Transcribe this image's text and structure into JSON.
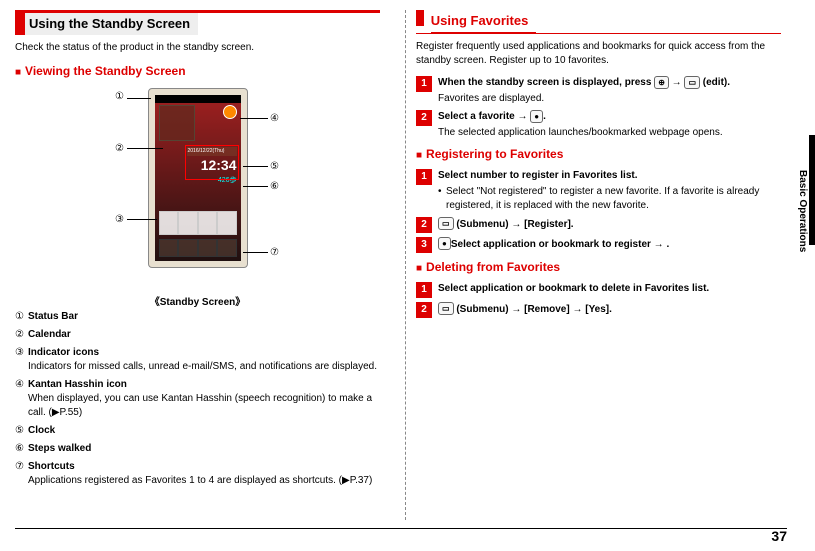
{
  "page_number": "37",
  "side_tab_label": "Basic Operations",
  "left_column": {
    "section_title": "Using the Standby Screen",
    "intro": "Check the status of the product in the standby screen.",
    "viewing_title": "Viewing the Standby Screen",
    "phone_caption": "《Standby Screen》",
    "labels": {
      "c1": "①",
      "c2": "②",
      "c3": "③",
      "c4": "④",
      "c5": "⑤",
      "c6": "⑥",
      "c7": "⑦"
    },
    "items": [
      {
        "num": "①",
        "title": "Status Bar",
        "desc": ""
      },
      {
        "num": "②",
        "title": "Calendar",
        "desc": ""
      },
      {
        "num": "③",
        "title": "Indicator icons",
        "desc": "Indicators for missed calls, unread e-mail/SMS, and notifications are displayed."
      },
      {
        "num": "④",
        "title": "Kantan Hasshin icon",
        "desc": "When displayed, you can use Kantan Hasshin (speech recognition) to make a call. (▶P.55)"
      },
      {
        "num": "⑤",
        "title": "Clock",
        "desc": ""
      },
      {
        "num": "⑥",
        "title": "Steps walked",
        "desc": ""
      },
      {
        "num": "⑦",
        "title": "Shortcuts",
        "desc": "Applications registered as Favorites 1 to 4 are displayed as shortcuts. (▶P.37)"
      }
    ],
    "phone": {
      "date_text": "2016/12/22(Thu)",
      "clock_text": "12:34",
      "steps_text": "426歩"
    }
  },
  "right_column": {
    "section_title": "Using Favorites",
    "intro": "Register frequently used applications and bookmarks for quick access from the standby screen. Register up to 10 favorites.",
    "main_steps": [
      {
        "num": "1",
        "title": "When the standby screen is displayed, press ",
        "key1": "⊕",
        "mid": " → ",
        "key2": "▭",
        "title_end": " (edit).",
        "desc": "Favorites are displayed."
      },
      {
        "num": "2",
        "title": "Select a favorite → ",
        "key1": "●",
        "title_end": ".",
        "desc": "The selected application launches/bookmarked webpage opens."
      }
    ],
    "registering_title": "Registering to Favorites",
    "registering_steps": [
      {
        "num": "1",
        "title": "Select number to register in Favorites list.",
        "bullet": "Select \"Not registered\" to register a new favorite. If a favorite is already registered, it is replaced with the new favorite."
      },
      {
        "num": "2",
        "title_pre": "",
        "key1": "▭",
        "title": " (Submenu) → [Register]."
      },
      {
        "num": "3",
        "title": "Select application or bookmark to register → ",
        "key1": "●",
        "title_end": "."
      }
    ],
    "deleting_title": "Deleting from Favorites",
    "deleting_steps": [
      {
        "num": "1",
        "title": "Select application or bookmark to delete in Favorites list."
      },
      {
        "num": "2",
        "key1": "▭",
        "title": " (Submenu) → [Remove] → [Yes]."
      }
    ]
  }
}
